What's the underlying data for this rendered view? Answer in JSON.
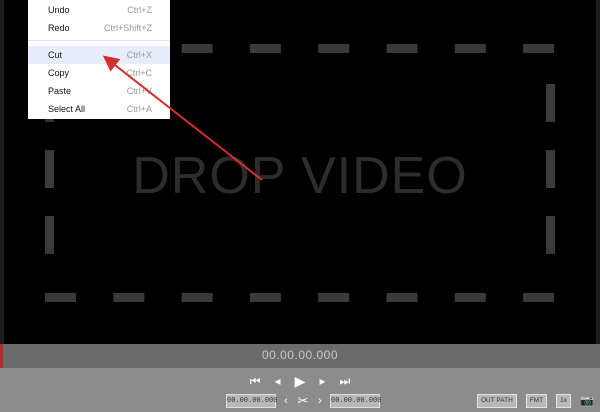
{
  "colors": {
    "accent": "#c0282e",
    "dashes": "#3a3a3a",
    "drop_text": "#2d2d2d"
  },
  "context_menu": {
    "items": [
      {
        "label": "Undo",
        "shortcut": "Ctrl+Z"
      },
      {
        "label": "Redo",
        "shortcut": "Ctrl+Shift+Z"
      },
      {
        "label": "Cut",
        "shortcut": "Ctrl+X"
      },
      {
        "label": "Copy",
        "shortcut": "Ctrl+C"
      },
      {
        "label": "Paste",
        "shortcut": "Ctrl+V"
      },
      {
        "label": "Select All",
        "shortcut": "Ctrl+A"
      }
    ],
    "highlighted_index": 2
  },
  "drop_zone": {
    "text": "DROP VIDEO"
  },
  "player": {
    "current_time": "00.00.00.000",
    "trim_start": "00.00.00.000",
    "trim_end": "00.00.00.000",
    "transport_icons": [
      "skip-start-icon",
      "step-back-icon",
      "play-icon",
      "step-forward-icon",
      "skip-end-icon"
    ]
  },
  "toolbar": {
    "out_path": "OUT PATH",
    "fmt": "FMT",
    "speed": "1x",
    "camera_icon": "camera-icon"
  }
}
